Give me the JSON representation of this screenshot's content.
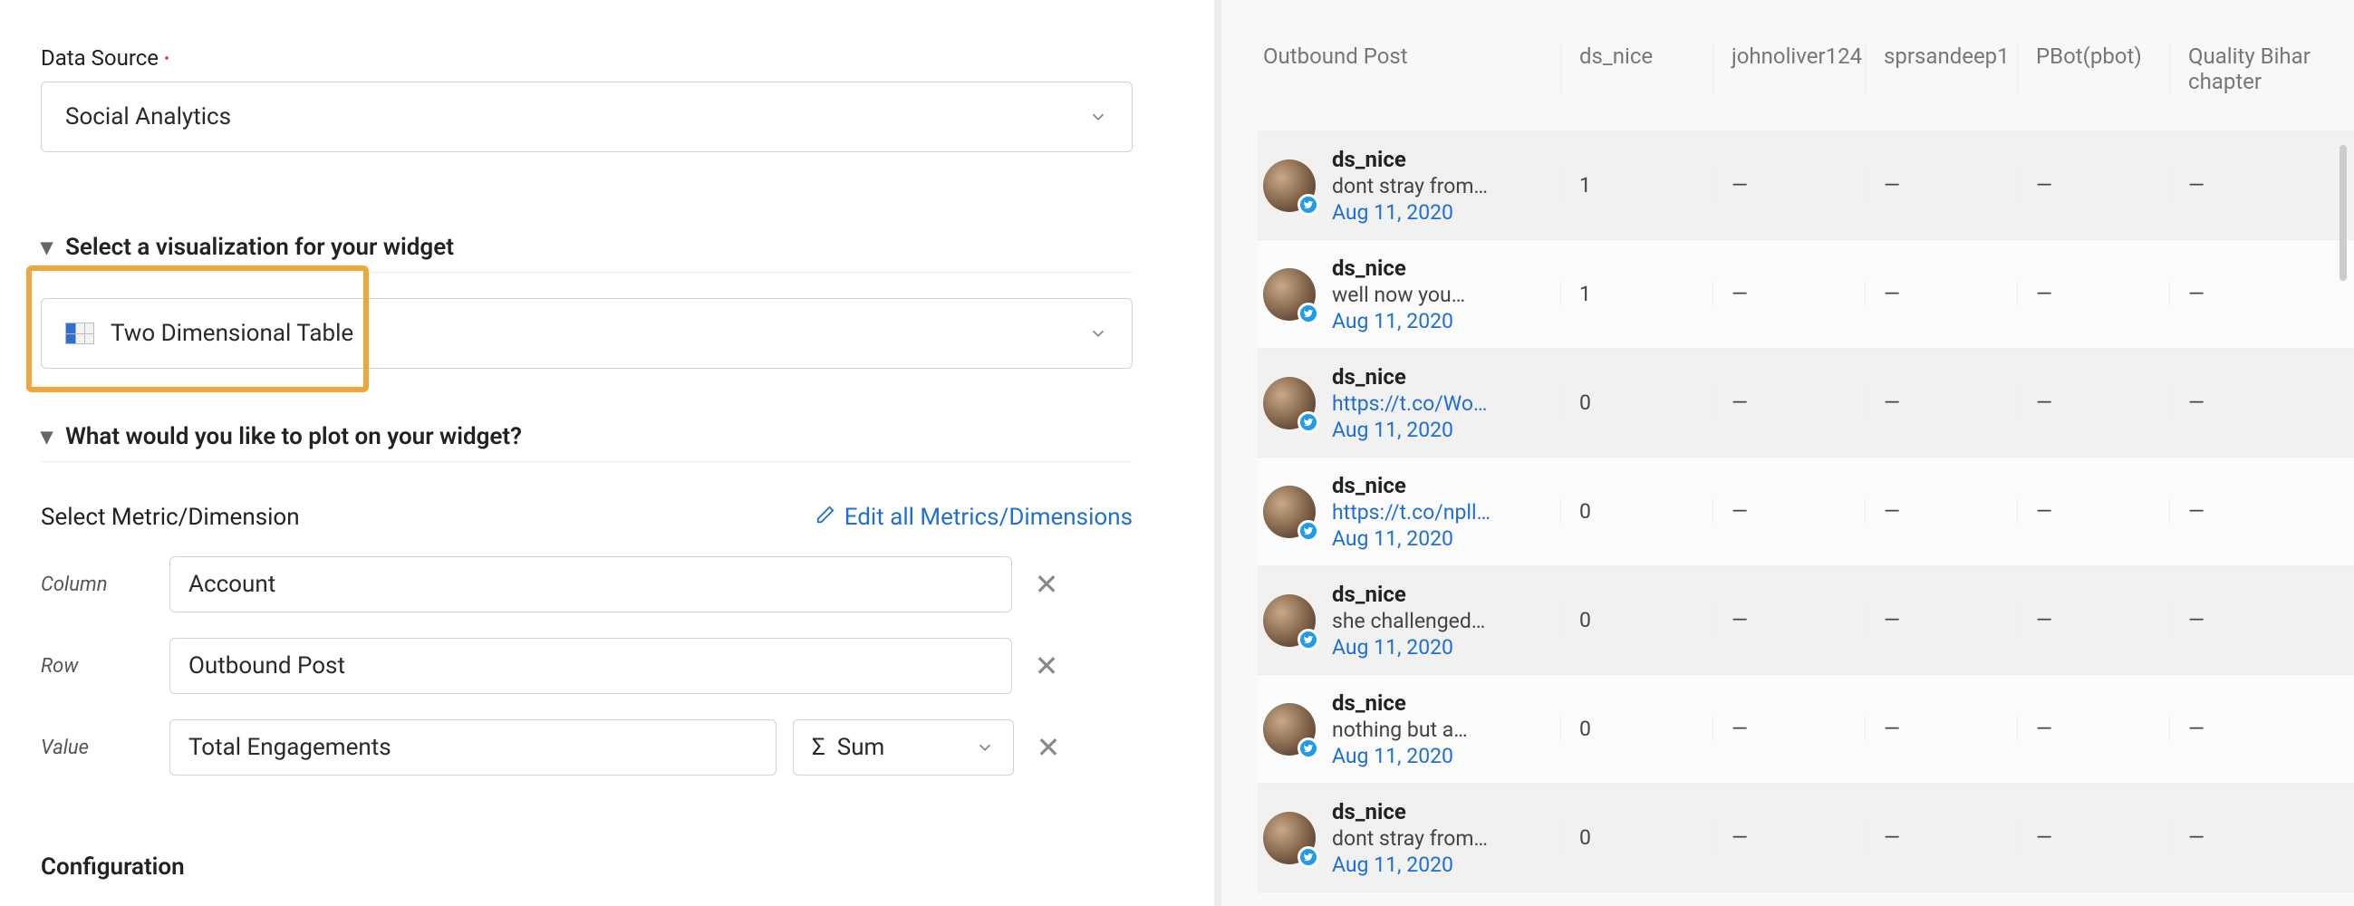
{
  "form": {
    "data_source_label": "Data Source",
    "data_source_value": "Social Analytics",
    "viz_section_title": "Select a visualization for your widget",
    "viz_value": "Two Dimensional Table",
    "plot_section_title": "What would you like to plot on your widget?",
    "metric_label": "Select Metric/Dimension",
    "edit_all_label": "Edit all Metrics/Dimensions",
    "column_label": "Column",
    "column_value": "Account",
    "row_label": "Row",
    "row_value": "Outbound Post",
    "value_label": "Value",
    "value_value": "Total Engagements",
    "agg_value": "Sum",
    "agg_sigma": "Σ",
    "config_title": "Configuration"
  },
  "table": {
    "headers": [
      "Outbound Post",
      "ds_nice",
      "johnoliver124",
      "sprsandeep1",
      "PBot(pbot)",
      "Quality Bihar chapter"
    ],
    "dash": "—",
    "rows": [
      {
        "name": "ds_nice",
        "body": "dont stray from…",
        "date": "Aug 11, 2020",
        "link": false,
        "v": "1"
      },
      {
        "name": "ds_nice",
        "body": "well now you…",
        "date": "Aug 11, 2020",
        "link": false,
        "v": "1"
      },
      {
        "name": "ds_nice",
        "body": "https://t.co/Wo…",
        "date": "Aug 11, 2020",
        "link": true,
        "v": "0"
      },
      {
        "name": "ds_nice",
        "body": "https://t.co/npll…",
        "date": "Aug 11, 2020",
        "link": true,
        "v": "0"
      },
      {
        "name": "ds_nice",
        "body": "she challenged…",
        "date": "Aug 11, 2020",
        "link": false,
        "v": "0"
      },
      {
        "name": "ds_nice",
        "body": "nothing but a…",
        "date": "Aug 11, 2020",
        "link": false,
        "v": "0"
      },
      {
        "name": "ds_nice",
        "body": "dont stray from…",
        "date": "Aug 11, 2020",
        "link": false,
        "v": "0"
      }
    ]
  }
}
